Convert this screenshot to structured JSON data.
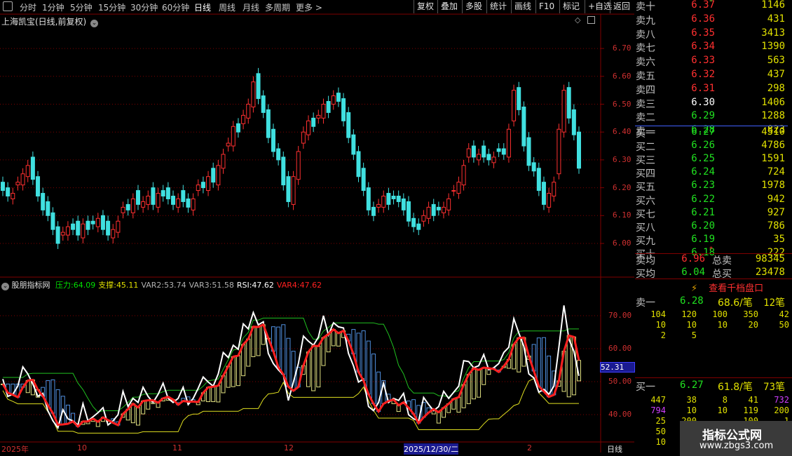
{
  "period_tabs": [
    "分时",
    "1分钟",
    "5分钟",
    "15分钟",
    "30分钟",
    "60分钟",
    "日线",
    "周线",
    "月线",
    "多周期",
    "更多 >"
  ],
  "active_period": "日线",
  "toolbar": [
    "复权",
    "叠加",
    "多股",
    "统计",
    "画线",
    "F10",
    "标记",
    "+自选",
    "返回"
  ],
  "stock_title": "上海凯宝(日线,前复权)",
  "price_axis": [
    "6.70",
    "6.60",
    "6.50",
    "6.40",
    "6.30",
    "6.20",
    "6.10",
    "6.00"
  ],
  "indicator": {
    "name": "股朋指标网",
    "values": [
      {
        "label": "压力:",
        "value": "64.09",
        "color": "#00e000"
      },
      {
        "label": "支撑:",
        "value": "45.11",
        "color": "#e0e000"
      },
      {
        "label": "VAR2:",
        "value": "53.74",
        "color": "#b0b0b0"
      },
      {
        "label": "VAR3:",
        "value": "51.58",
        "color": "#b0b0b0"
      },
      {
        "label": "RSI:",
        "value": "47.62",
        "color": "#ffffff"
      },
      {
        "label": "VAR4:",
        "value": "47.62",
        "color": "#ff2020"
      }
    ],
    "axis": [
      "70.00",
      "60.00",
      "50.00",
      "40.00"
    ],
    "current_tag": "52.31"
  },
  "x_axis": {
    "labels": [
      "2025年",
      "10",
      "11",
      "12",
      "2025/12/30/二",
      "2"
    ],
    "period_label": "日线"
  },
  "order_book": {
    "asks": [
      {
        "label": "卖十",
        "price": "6.37",
        "flag": "*",
        "vol": "1146"
      },
      {
        "label": "卖九",
        "price": "6.36",
        "flag": "",
        "vol": "431"
      },
      {
        "label": "卖八",
        "price": "6.35",
        "flag": "",
        "vol": "3413"
      },
      {
        "label": "卖七",
        "price": "6.34",
        "flag": "",
        "vol": "1390"
      },
      {
        "label": "卖六",
        "price": "6.33",
        "flag": "",
        "vol": "563"
      },
      {
        "label": "卖五",
        "price": "6.32",
        "flag": "",
        "vol": "437"
      },
      {
        "label": "卖四",
        "price": "6.31",
        "flag": "",
        "vol": "298"
      },
      {
        "label": "卖三",
        "price": "6.30",
        "flag": "",
        "vol": "1406"
      },
      {
        "label": "卖二",
        "price": "6.29",
        "flag": "",
        "vol": "1288"
      },
      {
        "label": "卖一",
        "price": "6.28",
        "flag": "",
        "vol": "823"
      }
    ],
    "bids": [
      {
        "label": "买一",
        "price": "6.27",
        "flag": "",
        "vol": "4510"
      },
      {
        "label": "买二",
        "price": "6.26",
        "flag": "",
        "vol": "4786"
      },
      {
        "label": "买三",
        "price": "6.25",
        "flag": "",
        "vol": "1591"
      },
      {
        "label": "买四",
        "price": "6.24",
        "flag": "",
        "vol": "724"
      },
      {
        "label": "买五",
        "price": "6.23",
        "flag": "",
        "vol": "1978"
      },
      {
        "label": "买六",
        "price": "6.22",
        "flag": "",
        "vol": "942"
      },
      {
        "label": "买七",
        "price": "6.21",
        "flag": "",
        "vol": "927"
      },
      {
        "label": "买八",
        "price": "6.20",
        "flag": "",
        "vol": "786"
      },
      {
        "label": "买九",
        "price": "6.19",
        "flag": "",
        "vol": "35"
      },
      {
        "label": "买十",
        "price": "6.18",
        "flag": "*",
        "vol": "222"
      }
    ],
    "avg_sell": {
      "label": "卖均",
      "price": "6.96",
      "total_label": "总卖",
      "total": "98345"
    },
    "avg_buy": {
      "label": "买均",
      "price": "6.04",
      "total_label": "总买",
      "total": "23478"
    },
    "qiandang_button": "查看千档盘口",
    "ask1_detail": {
      "label": "卖一",
      "price": "6.28",
      "per": "68.6/笔",
      "count": "12笔"
    },
    "ask_orders": [
      [
        "104",
        "120",
        "100",
        "350",
        "42"
      ],
      [
        "10",
        "10",
        "10",
        "20",
        "50"
      ],
      [
        "2",
        "5"
      ]
    ],
    "bid1_detail": {
      "label": "买一",
      "price": "6.27",
      "per": "61.8/笔",
      "count": "73笔"
    },
    "bid_orders": [
      [
        "447",
        "38",
        "8",
        "41",
        "732"
      ],
      [
        "794",
        "10",
        "10",
        "119",
        "200"
      ],
      [
        "25",
        "200",
        "",
        "100",
        "1"
      ],
      [
        "50"
      ],
      [
        "10"
      ]
    ]
  },
  "watermark": {
    "title": "指标公式网",
    "url": "www.zbgs3.com"
  },
  "colors": {
    "up": "#ff3030",
    "down": "#40e0e0",
    "grid": "#800000"
  }
}
